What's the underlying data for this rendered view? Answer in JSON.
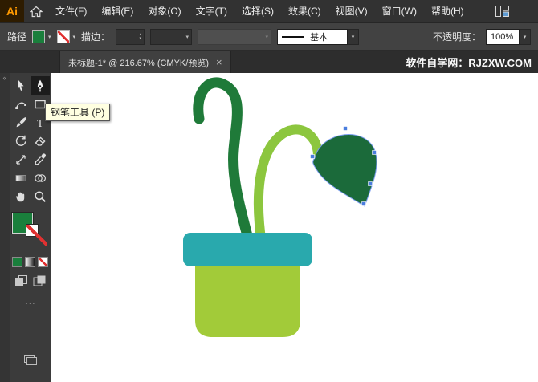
{
  "menubar": {
    "logo": "Ai",
    "items": [
      "文件(F)",
      "编辑(E)",
      "对象(O)",
      "文字(T)",
      "选择(S)",
      "效果(C)",
      "视图(V)",
      "窗口(W)",
      "帮助(H)"
    ]
  },
  "controlbar": {
    "selection_type": "路径",
    "stroke_label": "描边：",
    "brush_name": "基本",
    "opacity_label": "不透明度：",
    "opacity_value": "100%"
  },
  "tabbar": {
    "title": "未标题-1* @ 216.67% (CMYK/预览)",
    "watermark": "软件自学网：RJZXW.COM"
  },
  "toolbar": {
    "tools": [
      "selection-tool",
      "pen-tool",
      "curvature-tool",
      "rectangle-tool",
      "paintbrush-tool",
      "type-tool",
      "rotate-tool",
      "eraser-tool",
      "scale-tool",
      "eyedropper-tool",
      "gradient-tool",
      "shape-builder-tool",
      "hand-tool",
      "zoom-tool"
    ],
    "selected_tool": "pen-tool"
  },
  "tooltip": {
    "text": "钢笔工具 (P)"
  },
  "icons": {
    "close": "×",
    "collapse": "«",
    "dropdown": "▾",
    "spin_up": "▴",
    "spin_down": "▾",
    "more": "⋯"
  },
  "colors": {
    "fill_swatch_green": "#1a7f3c",
    "stroke_none_red": "#e03131",
    "pot_rim_teal": "#29a9ad",
    "pot_body_green": "#a2cb39",
    "stem_dark_green": "#1f7a39",
    "stem_light_green": "#8cc63e",
    "leaf_dark_green": "#1b6a3a",
    "selection_blue": "#4a7dde"
  }
}
